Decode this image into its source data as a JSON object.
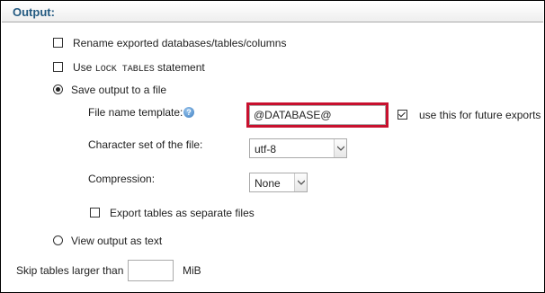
{
  "section": {
    "title": "Output:"
  },
  "options": {
    "rename_label": "Rename exported databases/tables/columns",
    "rename_checked": false,
    "use_label_prefix": "Use",
    "use_label_code": "LOCK TABLES",
    "use_label_suffix": "statement",
    "lock_checked": false
  },
  "output_mode": {
    "save_label": "Save output to a file",
    "save_selected": true,
    "view_label": "View output as text",
    "view_selected": false
  },
  "file": {
    "template_label": "File name template:",
    "template_value": "@DATABASE@",
    "future_label": "use this for future exports",
    "future_checked": true,
    "charset_label": "Character set of the file:",
    "charset_value": "utf-8",
    "compression_label": "Compression:",
    "compression_value": "None",
    "separate_label": "Export tables as separate files",
    "separate_checked": false
  },
  "skip": {
    "label": "Skip tables larger than",
    "value": "",
    "unit": "MiB"
  },
  "colors": {
    "header_text": "#235a81",
    "highlight": "#c8102e"
  }
}
